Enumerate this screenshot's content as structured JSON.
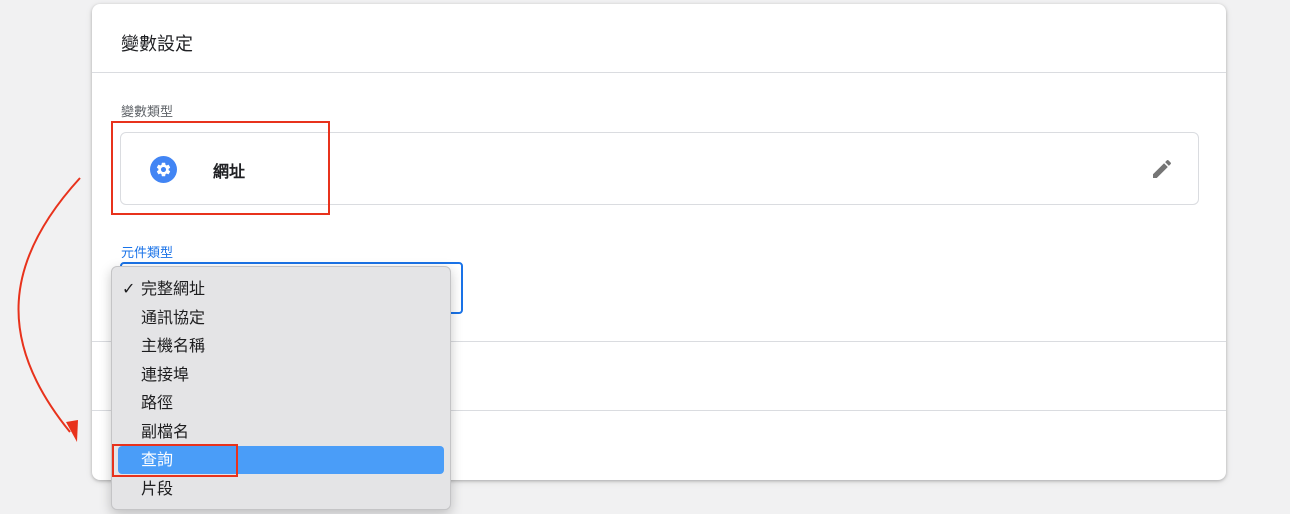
{
  "card": {
    "title": "變數設定",
    "variable_type_label": "變數類型",
    "variable_type_value": "網址",
    "variable_type_icon": "gear-icon",
    "component_type_label": "元件類型"
  },
  "dropdown": {
    "selected_check": "✓",
    "options": [
      {
        "label": "完整網址",
        "checked": true
      },
      {
        "label": "通訊協定"
      },
      {
        "label": "主機名稱"
      },
      {
        "label": "連接埠"
      },
      {
        "label": "路徑"
      },
      {
        "label": "副檔名"
      },
      {
        "label": "查詢",
        "highlighted": true
      },
      {
        "label": "片段"
      }
    ]
  },
  "colors": {
    "accent": "#1a73e8",
    "highlight": "#4a9df8",
    "annotation_red": "#e8321c"
  }
}
